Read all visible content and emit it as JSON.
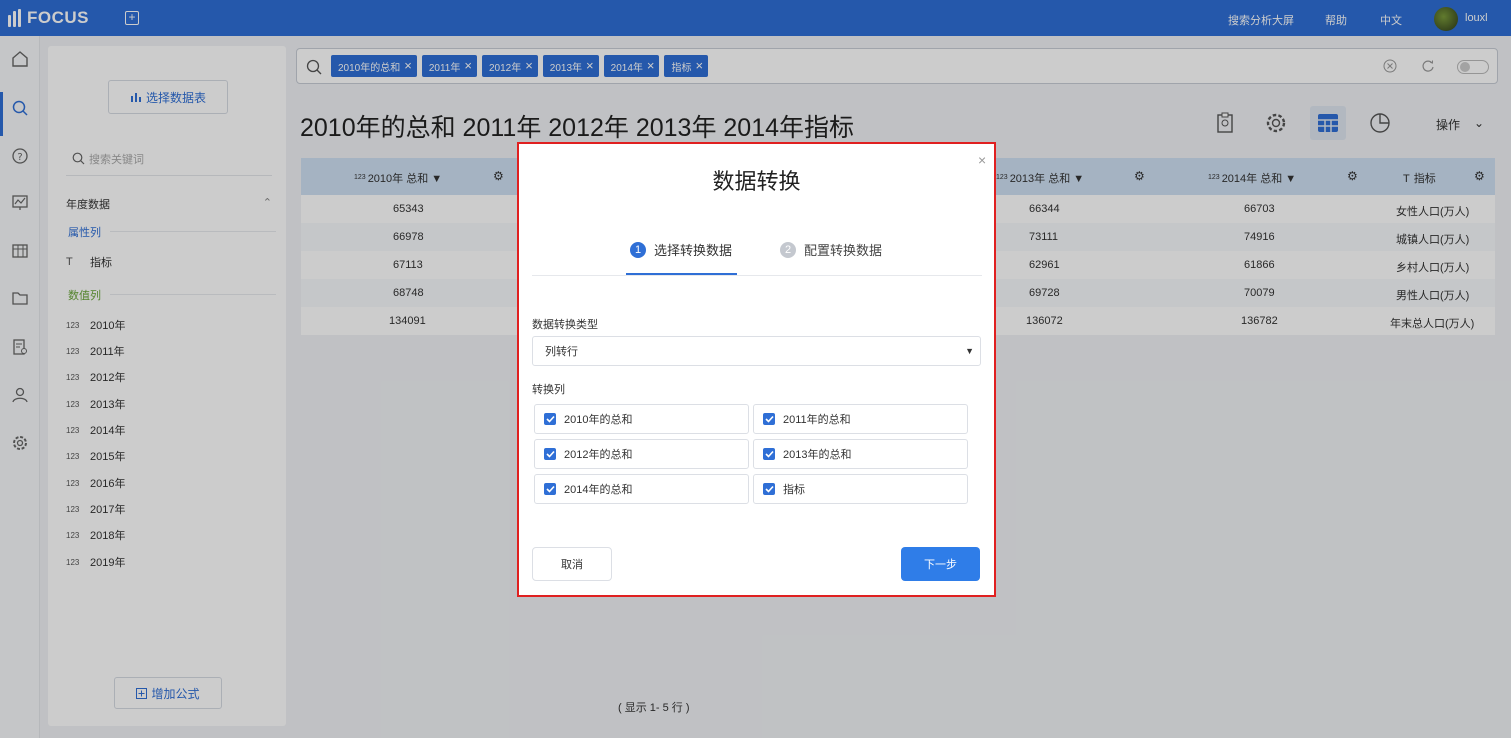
{
  "app": {
    "logo_text": "FOCUS",
    "top_links": [
      "搜索分析大屏",
      "帮助",
      "中文"
    ],
    "username": "louxl"
  },
  "sidebar": {
    "select_table_label": "选择数据表",
    "search_placeholder": "搜索关键词",
    "group_name": "年度数据",
    "attr_title": "属性列",
    "attr_items": [
      {
        "type": "T",
        "label": "指标"
      }
    ],
    "value_title": "数值列",
    "value_items": [
      {
        "type": "123",
        "label": "2010年"
      },
      {
        "type": "123",
        "label": "2011年"
      },
      {
        "type": "123",
        "label": "2012年"
      },
      {
        "type": "123",
        "label": "2013年"
      },
      {
        "type": "123",
        "label": "2014年"
      },
      {
        "type": "123",
        "label": "2015年"
      },
      {
        "type": "123",
        "label": "2016年"
      },
      {
        "type": "123",
        "label": "2017年"
      },
      {
        "type": "123",
        "label": "2018年"
      },
      {
        "type": "123",
        "label": "2019年"
      }
    ],
    "add_formula_label": "增加公式"
  },
  "search": {
    "chips": [
      "2010年的总和",
      "2011年",
      "2012年",
      "2013年",
      "2014年",
      "指标"
    ]
  },
  "main": {
    "title": "2010年的总和 2011年 2012年 2013年 2014年指标",
    "operation_label": "操作",
    "columns": [
      {
        "prefix": "123",
        "label": "2010年 总和"
      },
      {
        "prefix": "123",
        "label": "2013年 总和"
      },
      {
        "prefix": "123",
        "label": "2014年 总和"
      },
      {
        "prefix": "T",
        "label": "指标"
      }
    ],
    "rows": [
      [
        "65343",
        "66344",
        "66703",
        "女性人口(万人)"
      ],
      [
        "66978",
        "73111",
        "74916",
        "城镇人口(万人)"
      ],
      [
        "67113",
        "62961",
        "61866",
        "乡村人口(万人)"
      ],
      [
        "68748",
        "69728",
        "70079",
        "男性人口(万人)"
      ],
      [
        "134091",
        "136072",
        "136782",
        "年末总人口(万人)"
      ]
    ],
    "row_count_text": "( 显示 1- 5 行 )"
  },
  "modal": {
    "title": "数据转换",
    "step1_num": "1",
    "step1_label": "选择转换数据",
    "step2_num": "2",
    "step2_label": "配置转换数据",
    "type_label": "数据转换类型",
    "type_value": "列转行",
    "columns_label": "转换列",
    "columns": [
      "2010年的总和",
      "2011年的总和",
      "2012年的总和",
      "2013年的总和",
      "2014年的总和",
      "指标"
    ],
    "cancel_label": "取消",
    "next_label": "下一步"
  },
  "colors": {
    "brand": "#2f6fd6",
    "header_row": "#cfe0f3",
    "highlight_border": "#e02020"
  }
}
